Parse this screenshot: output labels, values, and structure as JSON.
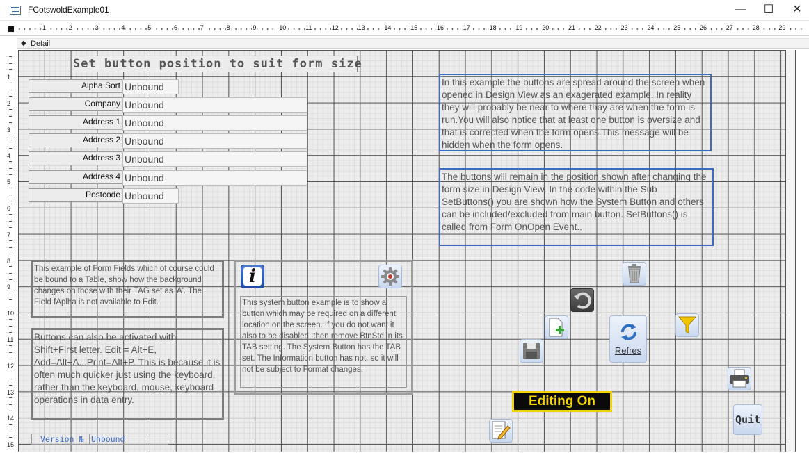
{
  "window": {
    "title": "FCotswoldExample01",
    "minimize": "—",
    "maximize": "☐",
    "close": "✕"
  },
  "section": {
    "name": "Detail"
  },
  "ruler": {
    "labels": [
      "1",
      "2",
      "3",
      "4",
      "5",
      "6",
      "7",
      "8",
      "9",
      "10",
      "11",
      "12",
      "13",
      "14",
      "15",
      "16",
      "17",
      "18",
      "19",
      "20",
      "21",
      "22",
      "23",
      "24",
      "25",
      "26",
      "27",
      "28",
      "29"
    ]
  },
  "vruler": {
    "labels": [
      "1",
      "2",
      "3",
      "4",
      "5",
      "6",
      "7",
      "8",
      "9",
      "10",
      "11",
      "12",
      "13",
      "14",
      "15"
    ]
  },
  "form": {
    "heading": "Set button position to suit form size",
    "fields": [
      {
        "label": "Alpha Sort",
        "value": "Unbound"
      },
      {
        "label": "Company",
        "value": "Unbound"
      },
      {
        "label": "Address 1",
        "value": "Unbound"
      },
      {
        "label": "Address 2",
        "value": "Unbound"
      },
      {
        "label": "Address 3",
        "value": "Unbound"
      },
      {
        "label": "Address 4",
        "value": "Unbound"
      },
      {
        "label": "Postcode",
        "value": "Unbound"
      }
    ],
    "note1": "In this example the buttons are spread around the screen when opened in Design View as an exagerated example. In reality they will probably be near to where thay are when the form is run.You will also notice that at least one button is oversize and that is corrected when the form opens.This message will be hidden when the form opens.",
    "note2": "The buttons will remain in the position shown after changing the form size in Design View. In the code within the Sub SetButtons() you are shown how the System Button and others can be included/excluded from main button. SetButtons() is called from Form OnOpen Event..",
    "note3": "This example of Form Fields which of course could be bound to a Table, show how the background changes on those with their TAG set as 'A'. The Field fAplha is not available to Edit.",
    "note4": "Buttons can also be activated with Shift+First letter. Edit = Alt+E, Add=Alt+A...Print=Alt+P. This is because it is often much quicker just using the keyboard, rather than the keyboard, mouse, keyboard operations in data entry.",
    "system_note": "This system button example is to show a button which may be required on a different location on the screen. If you do not want it also to be disabled, then remove BtnStd in its TAB setting. The System Button has the TAB set. The Information button has not, so it will not be subject to Format changes.",
    "editing": "Editing On",
    "refresh": "Refres",
    "quit": "Quit",
    "version_label": "Version №",
    "version_value": "Unbound"
  },
  "icons": {
    "info": "info-icon",
    "settings": "gear-icon",
    "delete": "trash-icon",
    "undo": "undo-icon",
    "add": "add-record-icon",
    "save": "save-icon",
    "refresh": "refresh-icon",
    "filter": "filter-icon",
    "print": "print-icon",
    "edit": "edit-icon"
  },
  "colors": {
    "accent": "#3d6bc4",
    "editing_bg": "#0a0a0a",
    "editing_fg": "#f2d500"
  }
}
